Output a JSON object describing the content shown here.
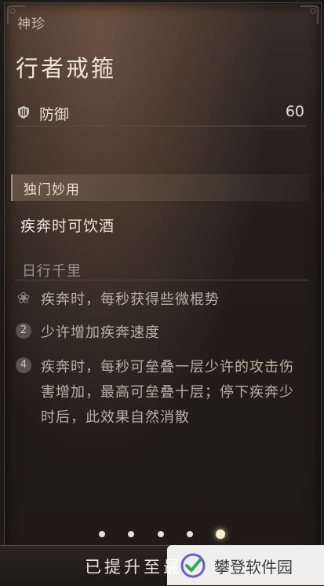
{
  "panel": {
    "category": "神珍",
    "title": "行者戒箍"
  },
  "stat": {
    "icon": "shield-icon",
    "label": "防御",
    "value": "60"
  },
  "special": {
    "section_label": "独门妙用",
    "effect": "疾奔时可饮酒"
  },
  "set_bonus": {
    "name": "日行千里",
    "effects": [
      {
        "icon": "flower-icon",
        "badge": "",
        "text": "疾奔时，每秒获得些微棍势"
      },
      {
        "icon": "tier-2-icon",
        "badge": "2",
        "text": "少许增加疾奔速度"
      },
      {
        "icon": "tier-4-icon",
        "badge": "4",
        "text": "疾奔时，每秒可垒叠一层少许的攻击伤害增加，最高可垒叠十层；停下疾奔少时后，此效果自然消散"
      }
    ]
  },
  "pager": {
    "count": 5,
    "active_index": 4
  },
  "bottom": {
    "status": "已提升至最"
  },
  "watermark": {
    "text": "攀登软件园"
  },
  "colors": {
    "background": "#1e1a17",
    "text_primary": "#eee5d9",
    "text_muted": "#bcb0a5",
    "section_bar": "#786450"
  }
}
